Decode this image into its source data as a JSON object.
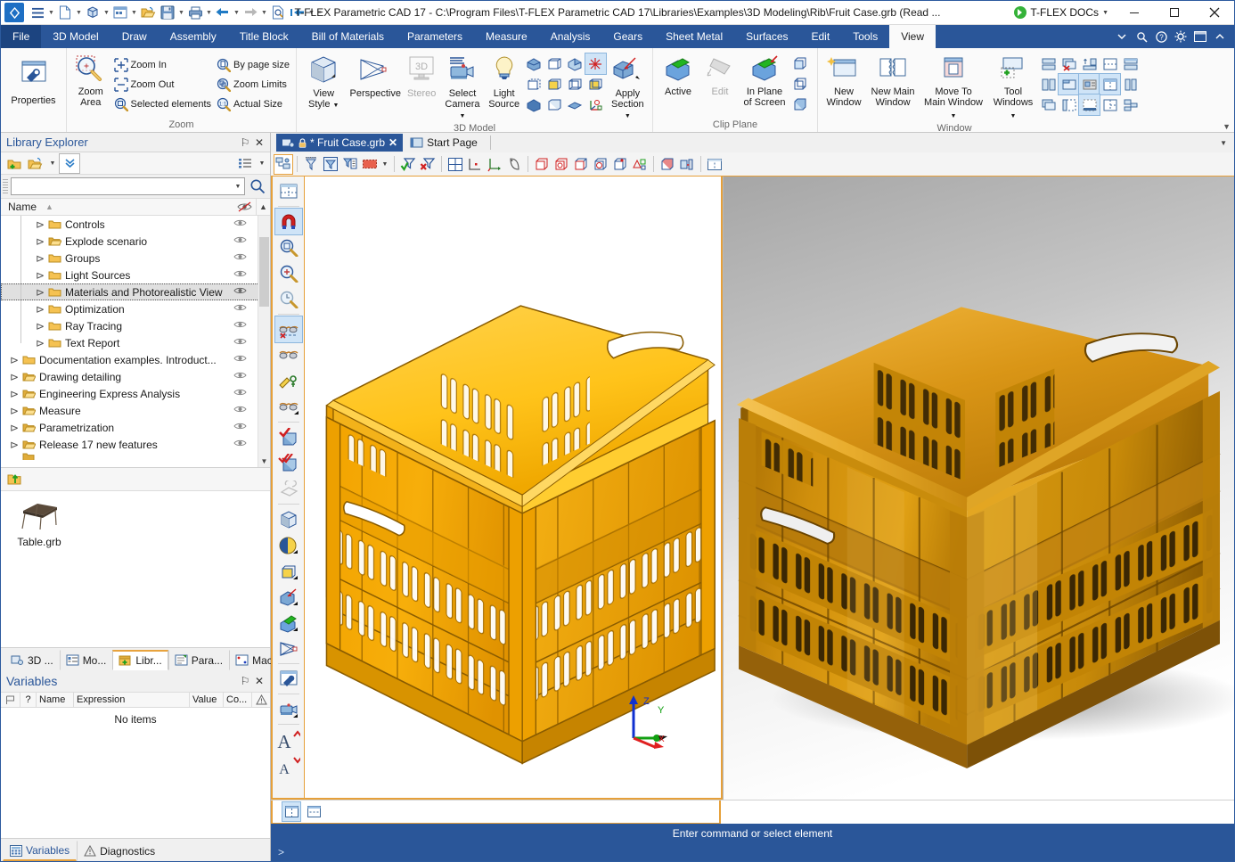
{
  "window": {
    "title": "T-FLEX Parametric CAD 17 - C:\\Program Files\\T-FLEX Parametric CAD 17\\Libraries\\Examples\\3D Modeling\\Rib\\Fruit Case.grb (Read ...",
    "docs_button": "T-FLEX DOCs",
    "minimize": "—",
    "maximize": "☐",
    "close": "✕",
    "accent": "#2a5699",
    "orange_accent": "#e6a03a"
  },
  "quick_access": [
    {
      "name": "app-menu-icon",
      "glyph": "☰"
    },
    {
      "name": "new-document-icon",
      "glyph": "doc"
    },
    {
      "name": "new-3d-model-icon",
      "glyph": "cube"
    },
    {
      "name": "new-assembly-icon",
      "glyph": "grid"
    },
    {
      "name": "open-icon",
      "glyph": "folder"
    },
    {
      "name": "save-icon",
      "glyph": "floppy"
    },
    {
      "name": "print-icon",
      "glyph": "printer"
    },
    {
      "name": "undo-icon",
      "glyph": "undo"
    },
    {
      "name": "redo-icon",
      "glyph": "redo"
    },
    {
      "name": "preview-icon",
      "glyph": "preview"
    },
    {
      "name": "back-icon",
      "glyph": "back"
    },
    {
      "name": "customize-icon",
      "glyph": "chevrons"
    }
  ],
  "ribbon_tabs": [
    {
      "label": "File",
      "active": false,
      "file": true
    },
    {
      "label": "3D Model",
      "active": false
    },
    {
      "label": "Draw",
      "active": false
    },
    {
      "label": "Assembly",
      "active": false
    },
    {
      "label": "Title Block",
      "active": false
    },
    {
      "label": "Bill of Materials",
      "active": false
    },
    {
      "label": "Parameters",
      "active": false
    },
    {
      "label": "Measure",
      "active": false
    },
    {
      "label": "Analysis",
      "active": false
    },
    {
      "label": "Gears",
      "active": false
    },
    {
      "label": "Sheet Metal",
      "active": false
    },
    {
      "label": "Surfaces",
      "active": false
    },
    {
      "label": "Edit",
      "active": false
    },
    {
      "label": "Tools",
      "active": false
    },
    {
      "label": "View",
      "active": true
    }
  ],
  "ribbon": {
    "properties": {
      "label": "Properties"
    },
    "zoom_group": {
      "title": "Zoom",
      "zoom_area": "Zoom\nArea",
      "zoom_area_line1": "Zoom",
      "zoom_area_line2": "Area",
      "items_col1": [
        "Zoom In",
        "Zoom Out",
        "Selected elements"
      ],
      "items_col2": [
        "By page size",
        "Zoom Limits",
        "Actual Size"
      ]
    },
    "model_group": {
      "title": "3D Model",
      "view_style_l1": "View",
      "view_style_l2": "Style",
      "perspective": "Perspective",
      "stereo": "Stereo",
      "select_camera_l1": "Select",
      "select_camera_l2": "Camera",
      "light_source_l1": "Light",
      "light_source_l2": "Source",
      "apply_section_l1": "Apply",
      "apply_section_l2": "Section"
    },
    "clip_group": {
      "title": "Clip Plane",
      "active": "Active",
      "edit": "Edit",
      "in_plane_l1": "In Plane",
      "in_plane_l2": "of Screen"
    },
    "window_group": {
      "title": "Window",
      "new_window_l1": "New",
      "new_window_l2": "Window",
      "new_main_l1": "New Main",
      "new_main_l2": "Window",
      "move_to_l1": "Move To",
      "move_to_l2": "Main Window",
      "tool_windows_l1": "Tool",
      "tool_windows_l2": "Windows"
    }
  },
  "library_explorer": {
    "title": "Library Explorer",
    "pin_glyph": "⚐",
    "close_glyph": "✕",
    "search_value": "",
    "search_placeholder": "",
    "column_header": "Name",
    "toolbar": [
      {
        "name": "add-library-icon"
      },
      {
        "name": "open-library-icon"
      },
      {
        "name": "dropdown-arrow-icon"
      },
      {
        "name": "collapse-all-icon"
      },
      {
        "name": "view-options-icon"
      }
    ],
    "tree": [
      {
        "label": "Controls",
        "indent": 2,
        "selected": false,
        "open_folder": false
      },
      {
        "label": "Explode scenario",
        "indent": 2,
        "selected": false,
        "open_folder": true
      },
      {
        "label": "Groups",
        "indent": 2,
        "selected": false,
        "open_folder": false
      },
      {
        "label": "Light Sources",
        "indent": 2,
        "selected": false,
        "open_folder": false
      },
      {
        "label": "Materials and Photorealistic View",
        "indent": 2,
        "selected": true,
        "open_folder": false
      },
      {
        "label": "Optimization",
        "indent": 2,
        "selected": false,
        "open_folder": false
      },
      {
        "label": "Ray Tracing",
        "indent": 2,
        "selected": false,
        "open_folder": false
      },
      {
        "label": "Text Report",
        "indent": 2,
        "selected": false,
        "open_folder": false,
        "last": true
      },
      {
        "label": "Documentation examples. Introduct...",
        "indent": 1,
        "selected": false,
        "open_folder": false
      },
      {
        "label": "Drawing detailing",
        "indent": 1,
        "selected": false,
        "open_folder": true
      },
      {
        "label": "Engineering Express Analysis",
        "indent": 1,
        "selected": false,
        "open_folder": true
      },
      {
        "label": "Measure",
        "indent": 1,
        "selected": false,
        "open_folder": true
      },
      {
        "label": "Parametrization",
        "indent": 1,
        "selected": false,
        "open_folder": true
      },
      {
        "label": "Release 17 new features",
        "indent": 1,
        "selected": false,
        "open_folder": true,
        "last": true
      }
    ],
    "preview_items": [
      {
        "name": "Table.grb"
      }
    ],
    "doc_tabs": [
      {
        "label": "3D ...",
        "active": false,
        "icon": "3d-model-icon"
      },
      {
        "label": "Mo...",
        "active": false,
        "icon": "model-tree-icon"
      },
      {
        "label": "Libr...",
        "active": true,
        "icon": "library-icon"
      },
      {
        "label": "Para...",
        "active": false,
        "icon": "parameters-icon"
      },
      {
        "label": "Mac...",
        "active": false,
        "icon": "macro-icon"
      }
    ]
  },
  "variables_panel": {
    "title": "Variables",
    "pin_glyph": "⚐",
    "close_glyph": "✕",
    "columns": [
      "",
      "?",
      "Name",
      "Expression",
      "Value",
      "Co...",
      ""
    ],
    "empty_text": "No items",
    "bottom_tabs": [
      {
        "label": "Variables",
        "active": true,
        "icon": "variables-icon"
      },
      {
        "label": "Diagnostics",
        "active": false,
        "icon": "warning-icon"
      }
    ]
  },
  "document_tabs": [
    {
      "label": "* Fruit Case.grb",
      "active": true,
      "locked": true,
      "closable": true,
      "icon": "3d-doc-icon"
    },
    {
      "label": "Start Page",
      "active": false,
      "locked": false,
      "closable": false,
      "icon": "start-page-icon"
    }
  ],
  "view_toolbar": [
    {
      "name": "model-structure-icon"
    },
    {
      "name": "filter-icon"
    },
    {
      "name": "filter-settings-icon"
    },
    {
      "name": "filter-list-icon"
    },
    {
      "name": "color-swatch-icon",
      "color": "#e8604c"
    },
    {
      "name": "color-dropdown-icon"
    },
    {
      "name": "select-visible-icon"
    },
    {
      "name": "deselect-icon"
    },
    {
      "name": "grid-icon"
    },
    {
      "name": "local-coordinate-icon"
    },
    {
      "name": "workplane-axis-icon"
    },
    {
      "name": "workplane-icon"
    },
    {
      "name": "3d-node-icon"
    },
    {
      "name": "3d-profile-icon"
    },
    {
      "name": "3d-path-icon"
    },
    {
      "name": "3d-section-icon"
    },
    {
      "name": "3d-point-icon"
    },
    {
      "name": "3d-fragment-icon"
    },
    {
      "name": "3d-face-icon"
    },
    {
      "name": "3d-body-icon"
    }
  ],
  "sidebar_3d": [
    {
      "name": "workplane-visibility-icon",
      "selected": false
    },
    {
      "name": "magnet-snap-icon",
      "selected": true
    },
    {
      "name": "zoom-selected-icon",
      "selected": false
    },
    {
      "name": "zoom-in-icon",
      "selected": false
    },
    {
      "name": "zoom-previous-icon",
      "selected": false
    },
    {
      "name": "hide-glasses-icon",
      "selected": true
    },
    {
      "name": "show-glasses-icon",
      "selected": false
    },
    {
      "name": "highlight-glasses-icon",
      "selected": false
    },
    {
      "name": "glasses-options-icon",
      "selected": false
    },
    {
      "name": "check-body-icon",
      "selected": false
    },
    {
      "name": "double-check-body-icon",
      "selected": false
    },
    {
      "name": "rotate-plane-icon",
      "selected": false,
      "disabled": true
    },
    {
      "name": "view-style-cube-icon",
      "selected": false
    },
    {
      "name": "render-sphere-icon",
      "selected": false
    },
    {
      "name": "shading-cube-icon",
      "selected": false
    },
    {
      "name": "clip-section-icon",
      "selected": false
    },
    {
      "name": "clip-plane-active-icon",
      "selected": false
    },
    {
      "name": "perspective-icon",
      "selected": false
    },
    {
      "name": "properties-icon",
      "selected": false
    },
    {
      "name": "camera-icon",
      "selected": false
    },
    {
      "name": "text-size-up-icon",
      "selected": false
    },
    {
      "name": "text-size-down-icon",
      "selected": false
    }
  ],
  "viewport": {
    "axis_labels": {
      "x": "X",
      "y": "Y",
      "z": "Z"
    },
    "axis_colors": {
      "x": "#e02020",
      "y": "#12a012",
      "z": "#1030d0"
    },
    "model_name": "Fruit Case",
    "model_color": "#f5a300",
    "model_color_light": "#ffc61a",
    "model_color_dark": "#c07d00",
    "left_background": "#ffffff",
    "right_background_top": "#b8b8b8",
    "right_background_bottom": "#ffffff"
  },
  "statusbar": {
    "message": "Enter command or select element",
    "command_prompt": ">"
  }
}
